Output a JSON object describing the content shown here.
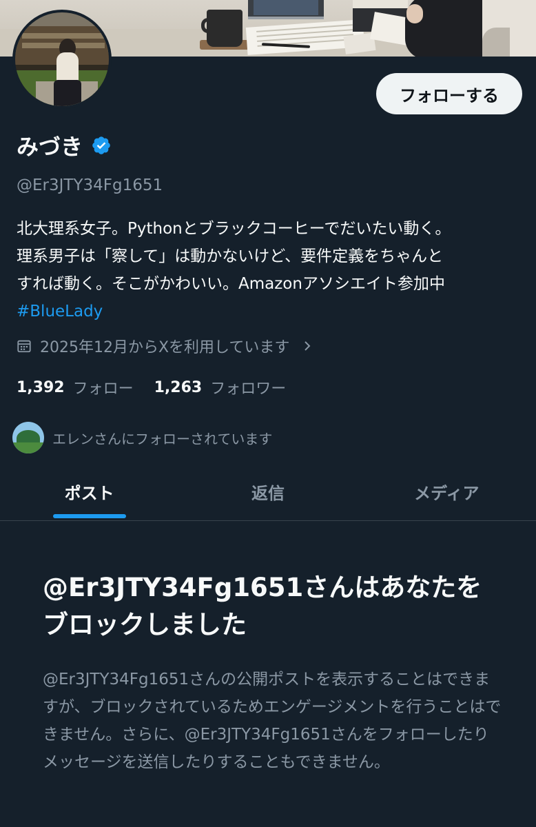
{
  "profile": {
    "display_name": "みづき",
    "handle": "@Er3JTY34Fg1651",
    "bio_lines": [
      "北大理系女子。Pythonとブラックコーヒーでだいたい動く。",
      "理系男子は「察して」は動かないけど、要件定義をちゃんと",
      "すれば動く。そこがかわいい。Amazonアソシエイト参加中"
    ],
    "bio_hashtag": "#BlueLady",
    "joined": "2025年12月からXを利用しています",
    "following_count": "1,392",
    "following_label": "フォロー",
    "followers_count": "1,263",
    "followers_label": "フォロワー",
    "followed_by": "エレンさんにフォローされています"
  },
  "actions": {
    "follow_label": "フォローする"
  },
  "tabs": [
    {
      "label": "ポスト",
      "active": true
    },
    {
      "label": "返信",
      "active": false
    },
    {
      "label": "メディア",
      "active": false
    }
  ],
  "blocked": {
    "title": "@Er3JTY34Fg1651さんはあなたをブロックしました",
    "description": "@Er3JTY34Fg1651さんの公開ポストを表示することはできますが、ブロックされているためエンゲージメントを行うことはできません。さらに、@Er3JTY34Fg1651さんをフォローしたりメッセージを送信したりすることもできません。"
  },
  "icons": {
    "verified": "verified-badge-icon",
    "calendar": "calendar-icon",
    "chevron": "chevron-right-icon"
  },
  "colors": {
    "background": "#15202b",
    "accent": "#1d9bf0",
    "text_primary": "#f7f9f9",
    "text_secondary": "#8b98a5"
  }
}
